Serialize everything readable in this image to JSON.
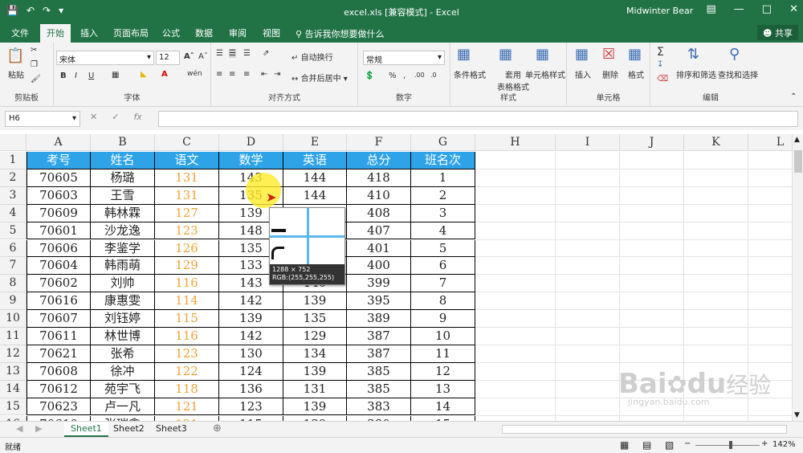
{
  "titlebar": {
    "title": "excel.xls  [兼容模式]  -  Excel",
    "user": "Midwinter Bear",
    "bg": "#217346"
  },
  "tabs": [
    {
      "label": "文件"
    },
    {
      "label": "开始"
    },
    {
      "label": "插入"
    },
    {
      "label": "页面布局"
    },
    {
      "label": "公式"
    },
    {
      "label": "数据"
    },
    {
      "label": "审阅"
    },
    {
      "label": "视图"
    }
  ],
  "tell_me": "告诉我你想要做什么",
  "share": "共享",
  "ribbon": {
    "clipboard": {
      "paste": "粘贴",
      "label": "剪贴板"
    },
    "font": {
      "name": "宋体",
      "size": "12",
      "label": "字体",
      "wen": "wén"
    },
    "alignment": {
      "wrap": "自动换行",
      "merge": "合并后居中",
      "label": "对齐方式"
    },
    "number": {
      "format": "常规",
      "label": "数字"
    },
    "styles": {
      "cond": "条件格式",
      "table1": "套用",
      "table2": "表格格式",
      "cell": "单元格样式",
      "label": "样式"
    },
    "cells": {
      "insert": "插入",
      "delete": "删除",
      "format": "格式",
      "label": "单元格"
    },
    "editing": {
      "sort": "排序和筛选",
      "find": "查找和选择",
      "label": "编辑"
    }
  },
  "formula_bar": {
    "namebox": "H6",
    "fx": "fx"
  },
  "columns": [
    "A",
    "B",
    "C",
    "D",
    "E",
    "F",
    "G",
    "H",
    "I",
    "J",
    "K",
    "L"
  ],
  "headers": [
    "考号",
    "姓名",
    "语文",
    "数学",
    "英语",
    "总分",
    "班名次"
  ],
  "rows": [
    [
      "70605",
      "杨璐",
      "131",
      "143",
      "144",
      "418",
      "1"
    ],
    [
      "70603",
      "王雪",
      "131",
      "135",
      "144",
      "410",
      "2"
    ],
    [
      "70609",
      "韩林霖",
      "127",
      "139",
      "142",
      "408",
      "3"
    ],
    [
      "70601",
      "沙龙逸",
      "123",
      "148",
      "136",
      "407",
      "4"
    ],
    [
      "70606",
      "李鉴学",
      "126",
      "135",
      "140",
      "401",
      "5"
    ],
    [
      "70604",
      "韩雨萌",
      "129",
      "133",
      "138",
      "400",
      "6"
    ],
    [
      "70602",
      "刘帅",
      "116",
      "143",
      "140",
      "399",
      "7"
    ],
    [
      "70616",
      "康惠雯",
      "114",
      "142",
      "139",
      "395",
      "8"
    ],
    [
      "70607",
      "刘钰婷",
      "115",
      "139",
      "135",
      "389",
      "9"
    ],
    [
      "70611",
      "林世博",
      "116",
      "142",
      "129",
      "387",
      "10"
    ],
    [
      "70621",
      "张希",
      "123",
      "130",
      "134",
      "387",
      "11"
    ],
    [
      "70608",
      "徐冲",
      "122",
      "124",
      "139",
      "385",
      "12"
    ],
    [
      "70612",
      "苑宇飞",
      "118",
      "136",
      "131",
      "385",
      "13"
    ],
    [
      "70623",
      "卢一凡",
      "121",
      "123",
      "139",
      "383",
      "14"
    ],
    [
      "70610",
      "张瑞鑫",
      "121",
      "115",
      "139",
      "380",
      "15"
    ]
  ],
  "row_numbers": [
    "1",
    "2",
    "3",
    "4",
    "5",
    "6",
    "7",
    "8",
    "9",
    "10",
    "11",
    "12",
    "13",
    "14",
    "15",
    "16"
  ],
  "colors": {
    "header_fill": "#2ea3e8",
    "chinese_score": "#f2a23a",
    "accent": "#217346"
  },
  "popup": {
    "size": "1288 × 752",
    "rgb": "RGB:(255,255,255)"
  },
  "sheets": [
    {
      "label": "Sheet1"
    },
    {
      "label": "Sheet2"
    },
    {
      "label": "Sheet3"
    }
  ],
  "status": {
    "ready": "就绪",
    "zoom": "142%"
  },
  "watermark": {
    "brand": "Bai",
    "brand2": "du",
    "cn": "经验",
    "url": "jingyan.baidu.com"
  }
}
